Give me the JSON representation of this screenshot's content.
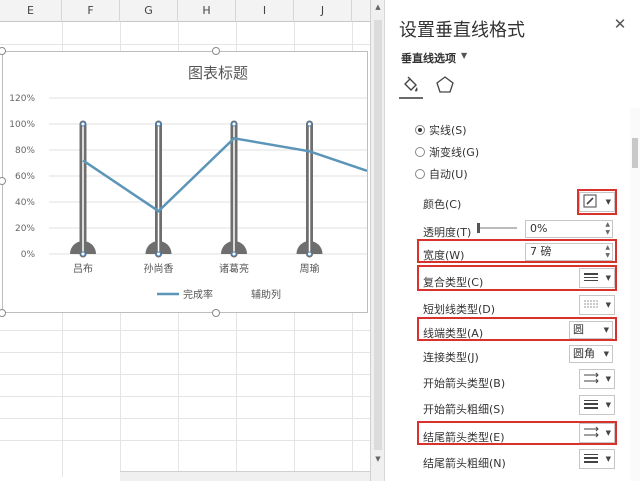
{
  "sheet": {
    "columns": [
      "E",
      "F",
      "G",
      "H",
      "I",
      "J"
    ]
  },
  "chart": {
    "title": "图表标题",
    "chart_data": {
      "type": "line",
      "categories": [
        "吕布",
        "孙尚香",
        "诸葛亮",
        "周瑜"
      ],
      "series": [
        {
          "name": "完成率",
          "values": [
            0.72,
            0.33,
            0.89,
            0.79
          ],
          "color": "#5b95b8"
        },
        {
          "name": "辅助列",
          "values": [
            1.0,
            1.0,
            1.0,
            1.0
          ],
          "color": "#6e6e6e"
        }
      ],
      "y_ticks": [
        "0%",
        "20%",
        "40%",
        "60%",
        "80%",
        "100%",
        "120%"
      ],
      "ylim": [
        0,
        1.2
      ],
      "legend": [
        "完成率",
        "辅助列"
      ],
      "legend_position": "bottom",
      "grid": true
    }
  },
  "pane": {
    "title": "设置垂直线格式",
    "close": "✕",
    "section": "垂直线选项",
    "tabs": [
      {
        "icon": "paint-bucket-icon"
      },
      {
        "icon": "pentagon-icon"
      }
    ],
    "line_options": {
      "solid": "实线(S)",
      "gradient": "渐变线(G)",
      "auto": "自动(U)",
      "selected": "solid"
    },
    "rows": {
      "color": "颜色(C)",
      "transparency": "透明度(T)",
      "transparency_value": "0%",
      "width": "宽度(W)",
      "width_value": "7 磅",
      "compound": "复合类型(C)",
      "dash": "短划线类型(D)",
      "cap": "线端类型(A)",
      "cap_value": "圆",
      "join": "连接类型(J)",
      "join_value": "圆角",
      "begin_arrow": "开始箭头类型(B)",
      "begin_arrow_size": "开始箭头粗细(S)",
      "end_arrow": "结尾箭头类型(E)",
      "end_arrow_size": "结尾箭头粗细(N)"
    },
    "colors": {
      "highlight": "#d9312b",
      "accent": "#5b95b8"
    }
  }
}
